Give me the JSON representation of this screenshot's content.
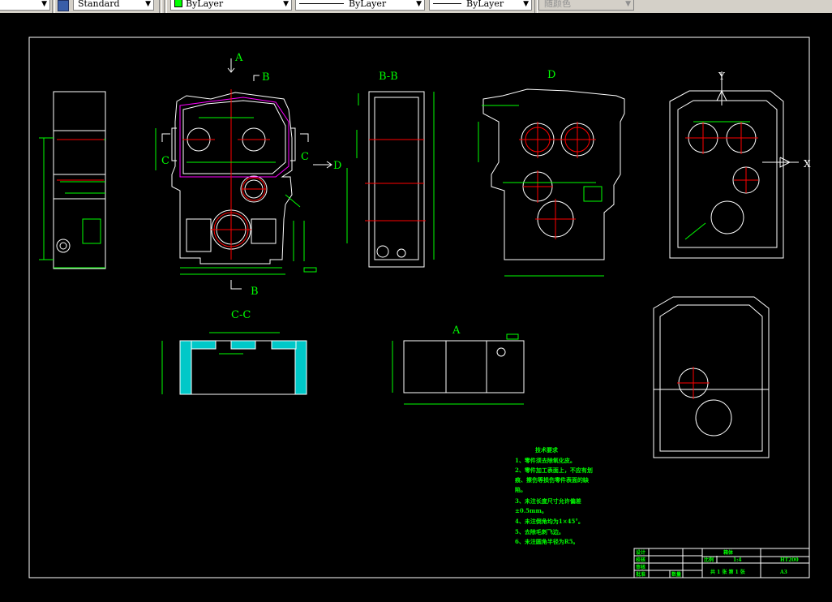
{
  "toolbar": {
    "style_value": "Standard",
    "color_value": "ByLayer",
    "linetype_value": "ByLayer",
    "lineweight_value": "ByLayer",
    "plotstyle_value": "随颜色",
    "color_swatch": "#00ff00"
  },
  "drawing": {
    "background": "#000000",
    "outline_color": "#ffffff",
    "dimension_color": "#00ff00",
    "centerline_color": "#ff0000",
    "gasket_color": "#ff00ff",
    "section_fill": "#00ffff",
    "labels": {
      "view_a_arrow": "A",
      "section_b_top": "B",
      "section_b_bottom": "B",
      "section_c_left": "C",
      "section_c_right": "C",
      "view_d_arrow": "D",
      "bb_title": "B-B",
      "d_title": "D",
      "cc_title": "C-C",
      "a_title": "A",
      "axis_y": "Y",
      "axis_x": "X"
    }
  },
  "tech_requirements": {
    "title": "技术要求",
    "lines": [
      "1、零件须去除氧化皮。",
      "2、零件加工表面上，不应有划",
      "痕、擦伤等损伤零件表面的缺",
      "陷。",
      "3、未注长度尺寸允许偏差",
      "±0.5mm。",
      "4、未注倒角均为1×45°。",
      "5、去除毛刺飞边。",
      "6、未注圆角半径为R5。"
    ]
  },
  "title_block": {
    "design": "设计",
    "check": "校核",
    "review": "审核",
    "approve": "批准",
    "part_name": "箱体",
    "scale_label": "比例",
    "scale_value": "1:4",
    "material": "HT200",
    "sheet": "共 1 张 第 1 张",
    "quantity": "数量",
    "code": "A3"
  }
}
